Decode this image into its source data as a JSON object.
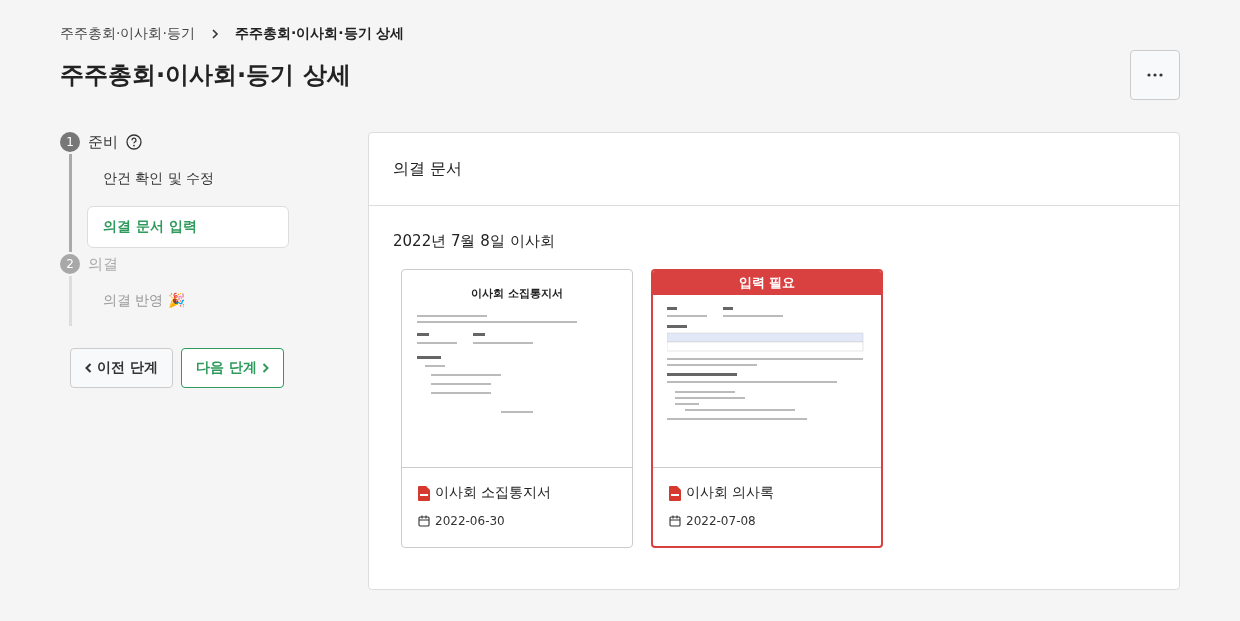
{
  "breadcrumb": [
    {
      "label": "주주총회·이사회·등기",
      "current": false
    },
    {
      "label": "주주총회·이사회·등기 상세",
      "current": true
    }
  ],
  "title": "주주총회·이사회·등기 상세",
  "steps": [
    {
      "number": "1",
      "label": "준비",
      "active": true,
      "help": true,
      "children": [
        {
          "label": "안건 확인 및 수정",
          "selected": false
        },
        {
          "label": "의결 문서 입력",
          "selected": true
        }
      ]
    },
    {
      "number": "2",
      "label": "의결",
      "active": false,
      "help": false,
      "children": [
        {
          "label": "의결 반영 🎉",
          "selected": false
        }
      ]
    }
  ],
  "nav_buttons": {
    "prev": "이전 단계",
    "next": "다음 단계"
  },
  "panel": {
    "title": "의결 문서",
    "section": "2022년 7월 8일 이사회",
    "documents": [
      {
        "preview_title": "이사회 소집통지서",
        "name": "이사회 소집통지서",
        "date": "2022-06-30",
        "needs_input": false
      },
      {
        "badge": "입력 필요",
        "name": "이사회 의사록",
        "date": "2022-07-08",
        "needs_input": true
      }
    ]
  }
}
